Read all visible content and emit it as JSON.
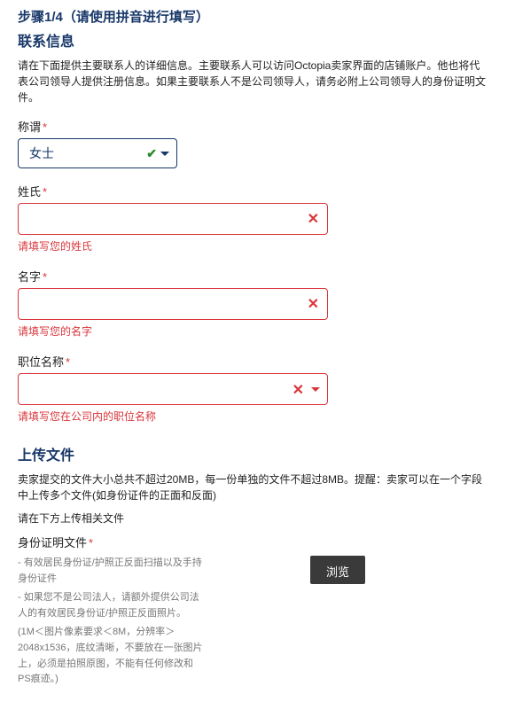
{
  "step": {
    "title": "步骤1/4（请使用拼音进行填写）"
  },
  "contact": {
    "heading": "联系信息",
    "desc": "请在下面提供主要联系人的详细信息。主要联系人可以访问Octopia卖家界面的店铺账户。他也将代表公司领导人提供注册信息。如果主要联系人不是公司领导人，请务必附上公司领导人的身份证明文件。",
    "salutation": {
      "label": "称谓",
      "value": "女士"
    },
    "lastname": {
      "label": "姓氏",
      "error": "请填写您的姓氏"
    },
    "firstname": {
      "label": "名字",
      "error": "请填写您的名字"
    },
    "jobtitle": {
      "label": "职位名称",
      "error": "请填写您在公司内的职位名称"
    }
  },
  "upload": {
    "heading": "上传文件",
    "desc": "卖家提交的文件大小总共不超过20MB，每一份单独的文件不超过8MB。提醒：卖家可以在一个字段中上传多个文件(如身份证件的正面和反面)",
    "prompt": "请在下方上传相关文件",
    "idproof_label": "身份证明文件",
    "tips": [
      "- 有效居民身份证/护照正反面扫描以及手持身份证件",
      "- 如果您不是公司法人，请额外提供公司法人的有效居民身份证/护照正反面照片。",
      "(1M＜图片像素要求＜8M，分辨率＞2048x1536，底纹清晰，不要放在一张图片上，必须是拍照原图，不能有任何修改和PS痕迹。)"
    ],
    "browse": "浏览"
  }
}
